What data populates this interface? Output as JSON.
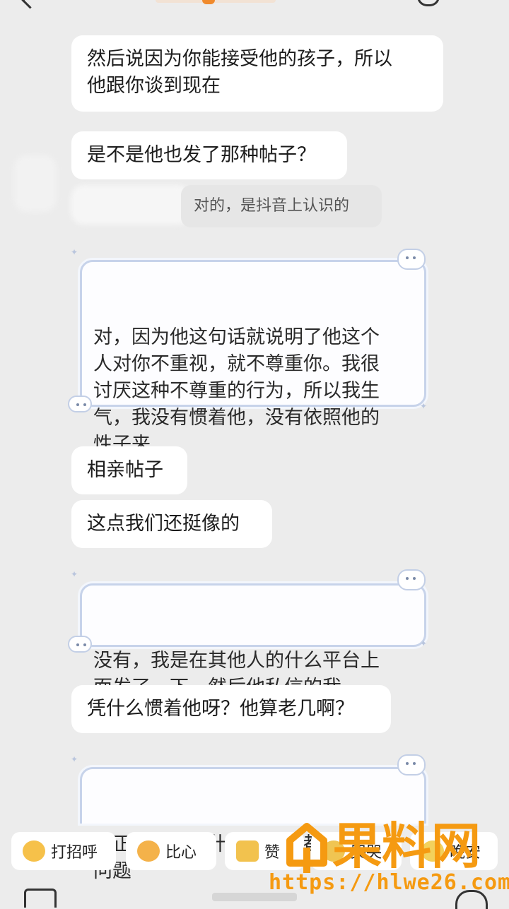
{
  "messages": [
    {
      "side": "left",
      "text": "然后说因为你能接受他的孩子，所以\n他跟你谈到现在"
    },
    {
      "side": "left",
      "text": "是不是他也发了那种帖子？"
    },
    {
      "side": "right",
      "text": "对的，是抖音上认识的"
    },
    {
      "side": "right",
      "style": "decorated",
      "text": "对，因为他这句话就说明了他这个\n人对你不重视，就不尊重你。我很\n讨厌这种不尊重的行为，所以我生\n气，我没有惯着他，没有依照他的\n性子来"
    },
    {
      "side": "left",
      "text": "相亲帖子"
    },
    {
      "side": "left",
      "text": "这点我们还挺像的"
    },
    {
      "side": "right",
      "style": "decorated",
      "text": "没有，我是在其他人的什么平台上\n面发了一下，然后他私信的我"
    },
    {
      "side": "left",
      "text": "凭什么惯着他呀？他算老几啊？"
    },
    {
      "side": "right",
      "style": "decorated",
      "text": "反正只要出了什么问题，都是他没\n问题"
    }
  ],
  "quick_replies": [
    {
      "label": "打招呼",
      "icon": "wave-emoji-icon"
    },
    {
      "label": "比心",
      "icon": "heart-hands-emoji-icon"
    },
    {
      "label": "赞",
      "icon": "thumbs-up-emoji-icon"
    },
    {
      "label": "哭哭",
      "icon": "cry-emoji-icon"
    },
    {
      "label": "晚安",
      "icon": "moon-emoji-icon"
    }
  ],
  "watermark": {
    "brand": "果料网",
    "url": "https://hlwe26.com",
    "color": "#f59a11"
  },
  "colors": {
    "background": "#ececec",
    "bubble": "#ffffff",
    "accent": "#f59a11"
  }
}
